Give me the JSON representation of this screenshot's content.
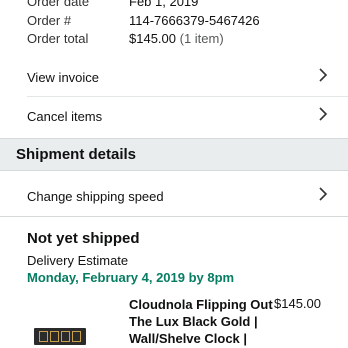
{
  "order": {
    "date_label": "Order date",
    "date_value": "Feb 1, 2019",
    "number_label": "Order #",
    "number_value": "114-7666379-5467426",
    "total_label": "Order total",
    "total_value": "$145.00",
    "total_items": "(1 item)"
  },
  "actions": {
    "view_invoice": "View invoice",
    "cancel_items": "Cancel items"
  },
  "shipment": {
    "section_title": "Shipment details",
    "change_speed": "Change shipping speed",
    "status": "Not yet shipped",
    "estimate_label": "Delivery Estimate",
    "estimate_date": "Monday, February 4, 2019 by 8pm"
  },
  "product": {
    "title": "Cloudnola Flipping Out The Lux Black Gold | Wall/Shelve Clock |",
    "price": "$145.00",
    "thumbnail_icon": "flip-clock-thumbnail"
  },
  "icons": {
    "chevron": "chevron-right-icon"
  },
  "colors": {
    "background": "#eaeded",
    "estimate_date": "#067d62"
  }
}
